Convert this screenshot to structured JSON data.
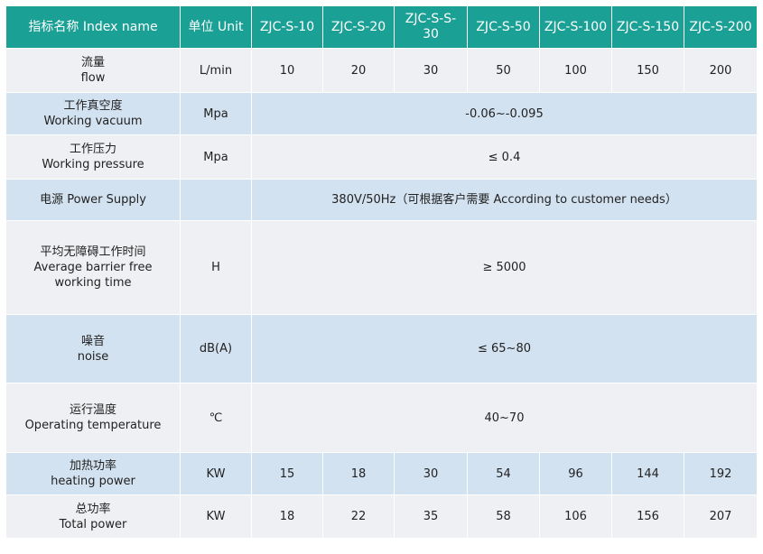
{
  "header": {
    "index_name": "指标名称 Index name",
    "unit": "单位 Unit",
    "models": [
      "ZJC-S-10",
      "ZJC-S-20",
      "ZJC-S-S-30",
      "ZJC-S-50",
      "ZJC-S-100",
      "ZJC-S-150",
      "ZJC-S-200"
    ]
  },
  "rows": {
    "flow": {
      "cn": "流量",
      "en": "flow",
      "unit": "L/min",
      "values": [
        "10",
        "20",
        "30",
        "50",
        "100",
        "150",
        "200"
      ]
    },
    "vacuum": {
      "cn": "工作真空度",
      "en": "Working vacuum",
      "unit": "Mpa",
      "value": "-0.06~-0.095"
    },
    "pressure": {
      "cn": "工作压力",
      "en": "Working pressure",
      "unit": "Mpa",
      "value": "≤ 0.4"
    },
    "power_supply": {
      "label": "电源 Power Supply",
      "unit": "",
      "value": "380V/50Hz（可根据客户需要 According to customer needs）"
    },
    "mtbf": {
      "cn": "平均无障碍工作时间",
      "en": "Average barrier free working time",
      "unit": "H",
      "value": "≥ 5000"
    },
    "noise": {
      "cn": "噪音",
      "en": "noise",
      "unit": "dB(A)",
      "value": "≤ 65~80"
    },
    "temperature": {
      "cn": "运行温度",
      "en": "Operating temperature",
      "unit": "℃",
      "value": "40~70"
    },
    "heating_power": {
      "cn": "加热功率",
      "en": "heating power",
      "unit": "KW",
      "values": [
        "15",
        "18",
        "30",
        "54",
        "96",
        "144",
        "192"
      ]
    },
    "total_power": {
      "cn": "总功率",
      "en": "Total power",
      "unit": "KW",
      "values": [
        "18",
        "22",
        "35",
        "58",
        "106",
        "156",
        "207"
      ]
    }
  },
  "colors": {
    "header_bg": "#1aa095",
    "row_light": "#eef0f3",
    "row_blue": "#d3e2f0"
  }
}
